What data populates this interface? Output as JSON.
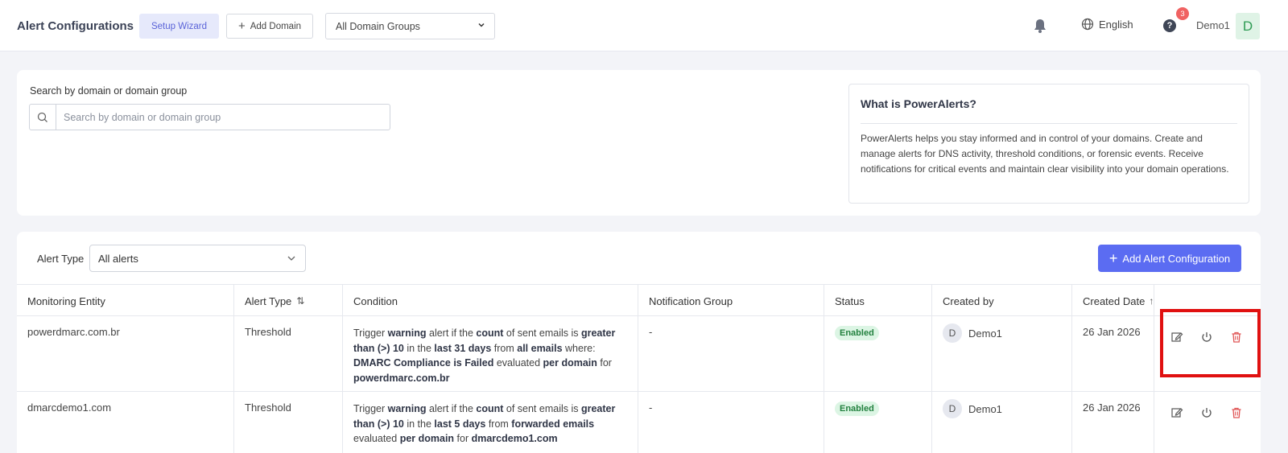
{
  "header": {
    "title": "Alert Configurations",
    "setup_wizard": "Setup Wizard",
    "add_domain": "Add Domain",
    "domain_group": "All Domain Groups",
    "language": "English",
    "help_badge": "3",
    "user_name": "Demo1",
    "user_initial": "D"
  },
  "search": {
    "label": "Search by domain or domain group",
    "placeholder": "Search by domain or domain group"
  },
  "info": {
    "title": "What is PowerAlerts?",
    "body": "PowerAlerts helps you stay informed and in control of your domains. Create and manage alerts for DNS activity, threshold conditions, or forensic events. Receive notifications for critical events and maintain clear visibility into your domain operations."
  },
  "filters": {
    "alert_type_label": "Alert Type",
    "alert_type_value": "All alerts",
    "add_config": "Add Alert Configuration"
  },
  "table": {
    "columns": [
      "Monitoring Entity",
      "Alert Type",
      "Condition",
      "Notification Group",
      "Status",
      "Created by",
      "Created Date"
    ],
    "rows": [
      {
        "entity": "powerdmarc.com.br",
        "type": "Threshold",
        "cond": {
          "a": "Trigger ",
          "b": "warning",
          "c": " alert if the ",
          "d": "count",
          "e": " of sent emails is ",
          "f": "greater than (>) 10",
          "g": " in the ",
          "h": "last 31 days",
          "i": " from ",
          "j": "all emails",
          "k": "  where: ",
          "l": "DMARC Compliance is Failed",
          "m": "  evaluated ",
          "n": "per domain",
          "o": " for ",
          "p": "powerdmarc.com.br"
        },
        "group": "-",
        "status": "Enabled",
        "created_by": "Demo1",
        "created_by_initial": "D",
        "date": "26 Jan 2026"
      },
      {
        "entity": "dmarcdemo1.com",
        "type": "Threshold",
        "cond": {
          "a": "Trigger ",
          "b": "warning",
          "c": " alert if the ",
          "d": "count",
          "e": " of sent emails is ",
          "f": "greater than (>) 10",
          "g": " in the ",
          "h": "last 5 days",
          "i": " from ",
          "j": "forwarded emails",
          "m": "  evaluated ",
          "n": "per domain",
          "o": " for ",
          "p": "dmarcdemo1.com"
        },
        "group": "-",
        "status": "Enabled",
        "created_by": "Demo1",
        "created_by_initial": "D",
        "date": "26 Jan 2026"
      }
    ]
  },
  "colors": {
    "primary": "#5b6cf2",
    "enabled_bg": "#dcf5e4",
    "enabled_text": "#23813f",
    "delete": "#e05656",
    "highlight": "#e01010"
  }
}
